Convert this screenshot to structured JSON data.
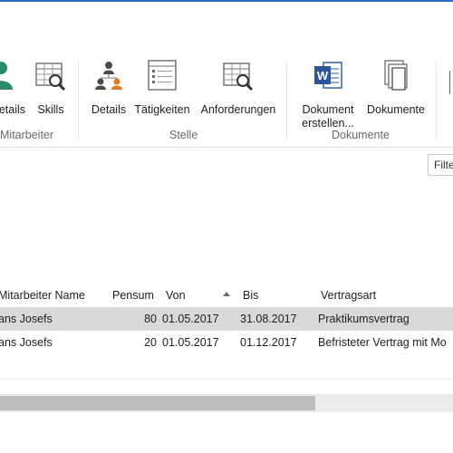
{
  "ribbon": {
    "groups": [
      {
        "label": "Mitarbeiter",
        "buttons": [
          {
            "label": "etails",
            "icon": "person-icon"
          },
          {
            "label": "Skills",
            "icon": "table-search-icon"
          }
        ]
      },
      {
        "label": "Stelle",
        "buttons": [
          {
            "label": "Details",
            "icon": "org-chart-icon"
          },
          {
            "label": "Tätigkeiten",
            "icon": "list-icon"
          },
          {
            "label": "Anforderungen",
            "icon": "table-search-icon"
          }
        ]
      },
      {
        "label": "Dokumente",
        "buttons": [
          {
            "label": "Dokument",
            "label2": "erstellen...",
            "icon": "word-doc-icon"
          },
          {
            "label": "Dokumente",
            "icon": "documents-icon"
          }
        ]
      }
    ]
  },
  "filter": {
    "label": "Filte"
  },
  "table": {
    "columns": [
      "Mitarbeiter Name",
      "Pensum",
      "Von",
      "Bis",
      "Vertragsart"
    ],
    "rows": [
      {
        "name": "ans Josefs",
        "pensum": "80",
        "von": "01.05.2017",
        "bis": "31.08.2017",
        "vertragsart": "Praktikumsvertrag",
        "selected": true
      },
      {
        "name": "ans Josefs",
        "pensum": "20",
        "von": "01.05.2017",
        "bis": "01.12.2017",
        "vertragsart": "Befristeter Vertrag mit Mo",
        "selected": false
      }
    ]
  },
  "colors": {
    "accent": "#2b6cc4",
    "selection": "#d9d9d9",
    "green_person": "#2e8b6a",
    "orange_person": "#e07a1f",
    "word_blue": "#2b579a"
  }
}
